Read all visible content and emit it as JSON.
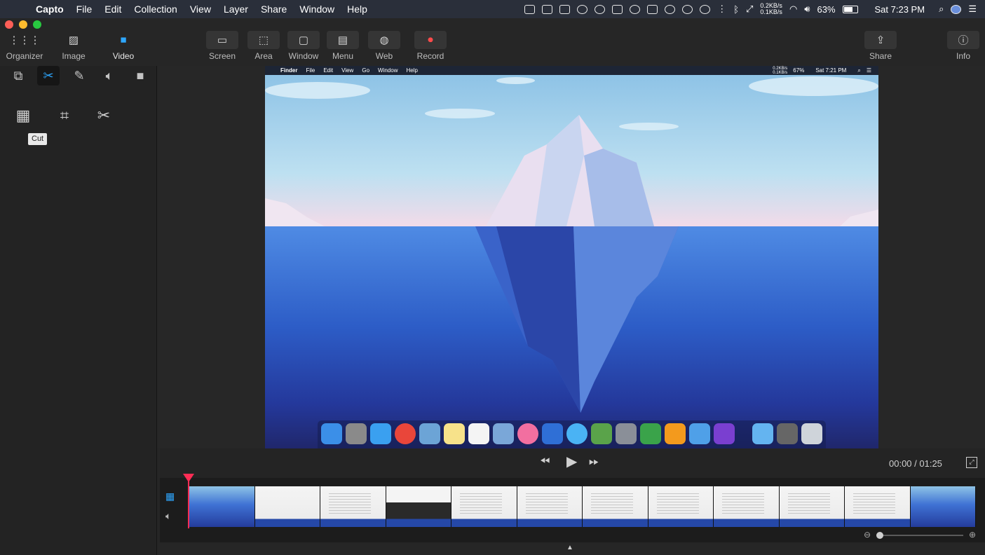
{
  "menubar": {
    "app_name": "Capto",
    "items": [
      "File",
      "Edit",
      "Collection",
      "View",
      "Layer",
      "Share",
      "Window",
      "Help"
    ],
    "net_up": "0.2KB/s",
    "net_down": "0.1KB/s",
    "battery": "63%",
    "clock": "Sat 7:23 PM"
  },
  "toolbar": {
    "organizer": "Organizer",
    "image": "Image",
    "video": "Video",
    "screen": "Screen",
    "area": "Area",
    "window": "Window",
    "menu": "Menu",
    "web": "Web",
    "record": "Record",
    "share": "Share",
    "info": "Info"
  },
  "tooltip": "Cut",
  "preview": {
    "menubar": {
      "app_name": "Finder",
      "items": [
        "File",
        "Edit",
        "View",
        "Go",
        "Window",
        "Help"
      ],
      "net_up": "0.2KB/s",
      "net_down": "0.1KB/s",
      "battery": "67%",
      "clock": "Sat 7:21 PM"
    }
  },
  "playback": {
    "timecode": "00:00 / 01:25"
  },
  "colors": {
    "accent": "#2ea7ff",
    "playhead": "#ff2d55"
  }
}
